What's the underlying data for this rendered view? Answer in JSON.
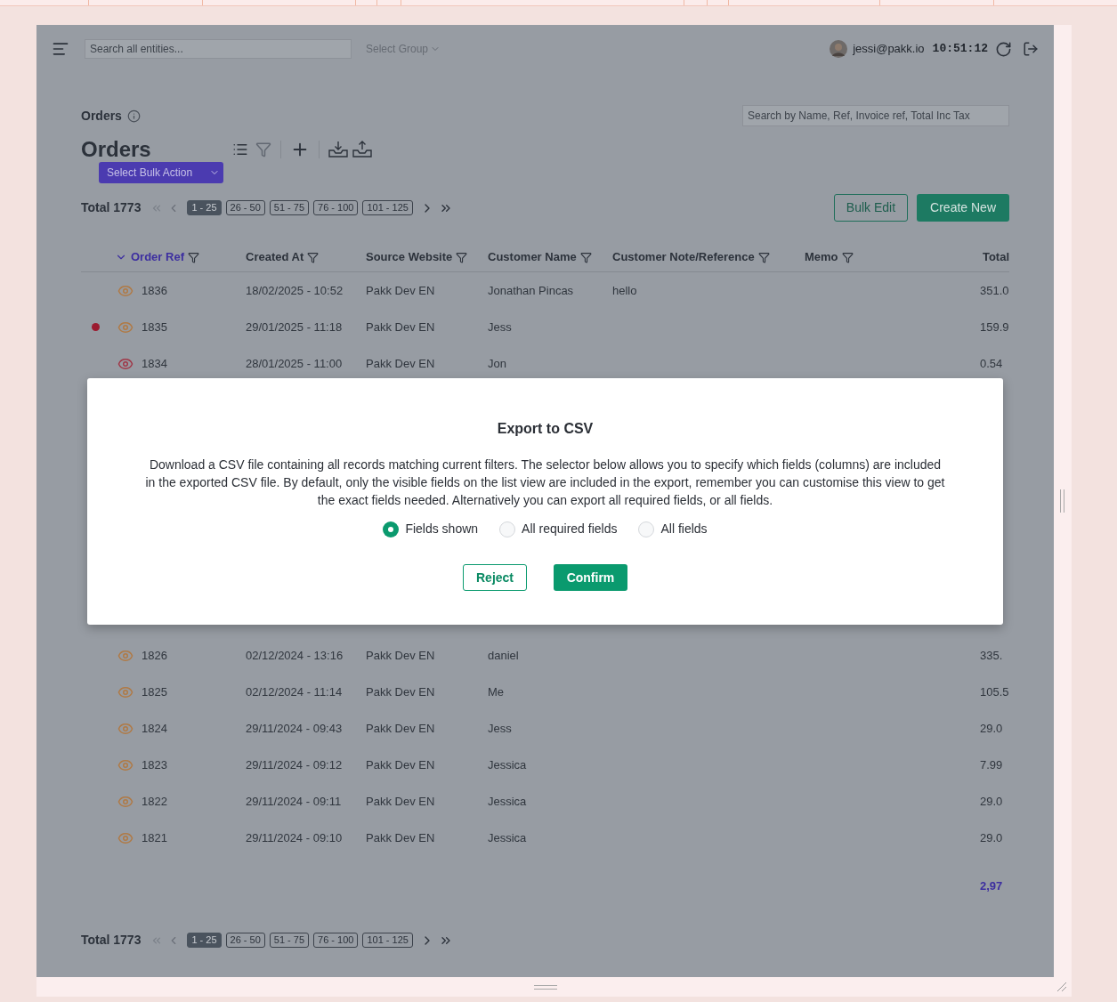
{
  "topbar": {
    "search_placeholder": "Search all entities...",
    "group_select": "Select Group",
    "user": "jessi@pakk.io",
    "time": "10:51:12"
  },
  "breadcrumb": "Orders",
  "title": "Orders",
  "bulk_action": "Select Bulk Action",
  "search_placeholder": "Search by Name, Ref, Invoice ref, Total Inc Tax",
  "pagination": {
    "total": "Total 1773",
    "pages": [
      {
        "label": "1 - 25",
        "selected": true
      },
      {
        "label": "26 - 50",
        "selected": false
      },
      {
        "label": "51 - 75",
        "selected": false
      },
      {
        "label": "76 - 100",
        "selected": false
      },
      {
        "label": "101 - 125",
        "selected": false
      }
    ]
  },
  "buttons": {
    "bulk_edit": "Bulk Edit",
    "create_new": "Create New"
  },
  "table": {
    "columns": [
      {
        "label": "Order Ref",
        "sorted": true
      },
      {
        "label": "Created At",
        "sorted": false
      },
      {
        "label": "Source Website",
        "sorted": false
      },
      {
        "label": "Customer Name",
        "sorted": false
      },
      {
        "label": "Customer Note/Reference",
        "sorted": false
      },
      {
        "label": "Memo",
        "sorted": false
      },
      {
        "label": "Total",
        "sorted": false
      }
    ],
    "rows_top": [
      {
        "flagged": false,
        "color": "#b07a45",
        "ref": "1836",
        "created": "18/02/2025 - 10:52",
        "source": "Pakk Dev EN",
        "customer": "Jonathan Pincas",
        "note": "hello",
        "total": "351.0"
      },
      {
        "flagged": true,
        "color": "#b07a45",
        "ref": "1835",
        "created": "29/01/2025 - 11:18",
        "source": "Pakk Dev EN",
        "customer": "Jess",
        "total": "159.9"
      },
      {
        "flagged": false,
        "color": "#a03848",
        "ref": "1834",
        "created": "28/01/2025 - 11:00",
        "source": "Pakk Dev EN",
        "customer": "Jon",
        "total": "0.54"
      }
    ],
    "rows_bottom": [
      {
        "flagged": false,
        "color": "#b07a45",
        "ref": "1826",
        "created": "02/12/2024 - 13:16",
        "source": "Pakk Dev EN",
        "customer": "daniel",
        "total": "335."
      },
      {
        "flagged": false,
        "color": "#b07a45",
        "ref": "1825",
        "created": "02/12/2024 - 11:14",
        "source": "Pakk Dev EN",
        "customer": "Me",
        "total": "105.5"
      },
      {
        "flagged": false,
        "color": "#b07a45",
        "ref": "1824",
        "created": "29/11/2024 - 09:43",
        "source": "Pakk Dev EN",
        "customer": "Jess",
        "total": "29.0"
      },
      {
        "flagged": false,
        "color": "#b07a45",
        "ref": "1823",
        "created": "29/11/2024 - 09:12",
        "source": "Pakk Dev EN",
        "customer": "Jessica",
        "total": "7.99"
      },
      {
        "flagged": false,
        "color": "#b07a45",
        "ref": "1822",
        "created": "29/11/2024 - 09:11",
        "source": "Pakk Dev EN",
        "customer": "Jessica",
        "total": "29.0"
      },
      {
        "flagged": false,
        "color": "#b07a45",
        "ref": "1821",
        "created": "29/11/2024 - 09:10",
        "source": "Pakk Dev EN",
        "customer": "Jessica",
        "total": "29.0"
      }
    ],
    "sum": "2,97"
  },
  "bottom_pagination": {
    "total": "Total 1773",
    "pages": [
      {
        "label": "1 - 25",
        "selected": true
      },
      {
        "label": "26 - 50",
        "selected": false
      },
      {
        "label": "51 - 75",
        "selected": false
      },
      {
        "label": "76 - 100",
        "selected": false
      },
      {
        "label": "101 - 125",
        "selected": false
      }
    ]
  },
  "dialog": {
    "title": "Export to CSV",
    "text": "Download a CSV file containing all records matching current filters. The selector below allows you to specify which fields (columns) are included in the exported CSV file. By default, only the visible fields on the list view are included in the export, remember you can customise this view to get the exact fields needed. Alternatively you can export all required fields, or all fields.",
    "options": [
      {
        "label": "Fields shown",
        "selected": true
      },
      {
        "label": "All required fields",
        "selected": false
      },
      {
        "label": "All fields",
        "selected": false
      }
    ],
    "reject": "Reject",
    "confirm": "Confirm"
  }
}
